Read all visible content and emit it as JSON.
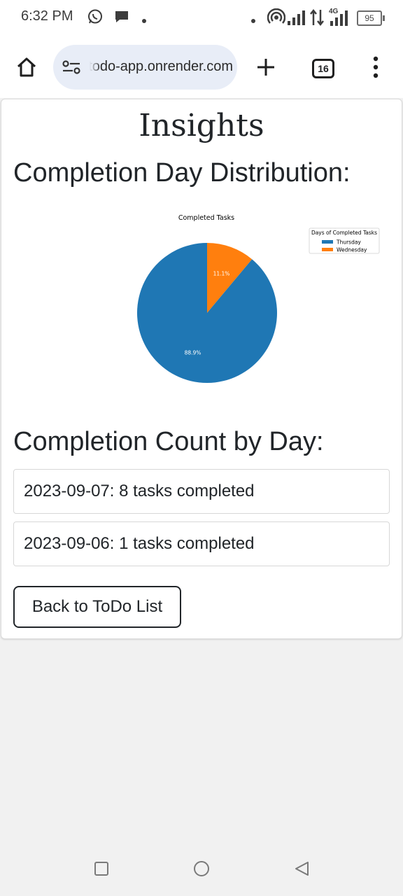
{
  "status_bar": {
    "time": "6:32 PM",
    "icons": [
      "whatsapp-icon",
      "message-icon",
      "dot-icon",
      "hotspot-icon",
      "signal-icon",
      "data-arrows-icon",
      "signal-4g-icon"
    ],
    "network_label": "4G",
    "battery": "95"
  },
  "browser": {
    "url": "todo-app.onrender.com",
    "tab_count": "16",
    "icons": [
      "home-icon",
      "site-settings-icon",
      "new-tab-icon",
      "tabs-icon",
      "menu-icon"
    ]
  },
  "page": {
    "title": "Insights",
    "distribution_heading": "Completion Day Distribution:",
    "count_heading": "Completion Count by Day:",
    "counts": [
      {
        "text": "2023-09-07: 8 tasks completed"
      },
      {
        "text": "2023-09-06: 1 tasks completed"
      }
    ],
    "back_button": "Back to ToDo List"
  },
  "chart_data": {
    "type": "pie",
    "title": "Completed Tasks",
    "legend_title": "Days of Completed Tasks",
    "legend_position": "top-right",
    "categories": [
      "Thursday",
      "Wednesday"
    ],
    "values": [
      88.9,
      11.1
    ],
    "labels": [
      "88.9%",
      "11.1%"
    ],
    "colors": [
      "#1f77b4",
      "#ff7f0e"
    ]
  },
  "nav_bar": {
    "icons": [
      "recents-icon",
      "home-circle-icon",
      "back-icon"
    ]
  }
}
